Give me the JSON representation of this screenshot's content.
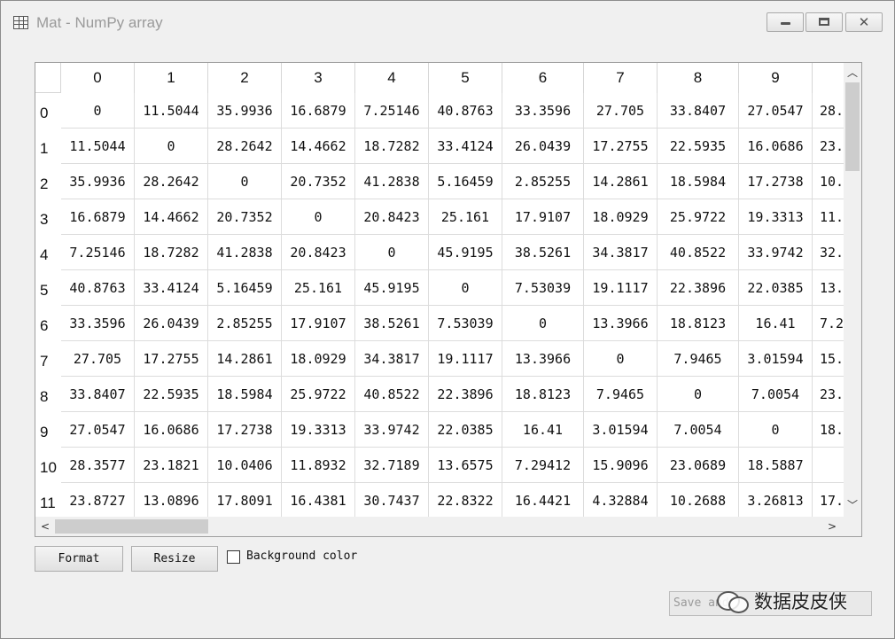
{
  "window": {
    "title": "Mat - NumPy array",
    "icon": "table-icon",
    "controls": [
      "minimize-icon",
      "maximize-icon",
      "close-icon"
    ]
  },
  "table": {
    "columns": [
      "0",
      "1",
      "2",
      "3",
      "4",
      "5",
      "6",
      "7",
      "8",
      "9"
    ],
    "rows": [
      {
        "label": "0",
        "cells": [
          "0",
          "11.5044",
          "35.9936",
          "16.6879",
          "7.25146",
          "40.8763",
          "33.3596",
          "27.705",
          "33.8407",
          "27.0547",
          "28."
        ]
      },
      {
        "label": "1",
        "cells": [
          "11.5044",
          "0",
          "28.2642",
          "14.4662",
          "18.7282",
          "33.4124",
          "26.0439",
          "17.2755",
          "22.5935",
          "16.0686",
          "23."
        ]
      },
      {
        "label": "2",
        "cells": [
          "35.9936",
          "28.2642",
          "0",
          "20.7352",
          "41.2838",
          "5.16459",
          "2.85255",
          "14.2861",
          "18.5984",
          "17.2738",
          "10."
        ]
      },
      {
        "label": "3",
        "cells": [
          "16.6879",
          "14.4662",
          "20.7352",
          "0",
          "20.8423",
          "25.161",
          "17.9107",
          "18.0929",
          "25.9722",
          "19.3313",
          "11."
        ]
      },
      {
        "label": "4",
        "cells": [
          "7.25146",
          "18.7282",
          "41.2838",
          "20.8423",
          "0",
          "45.9195",
          "38.5261",
          "34.3817",
          "40.8522",
          "33.9742",
          "32."
        ]
      },
      {
        "label": "5",
        "cells": [
          "40.8763",
          "33.4124",
          "5.16459",
          "25.161",
          "45.9195",
          "0",
          "7.53039",
          "19.1117",
          "22.3896",
          "22.0385",
          "13."
        ]
      },
      {
        "label": "6",
        "cells": [
          "33.3596",
          "26.0439",
          "2.85255",
          "17.9107",
          "38.5261",
          "7.53039",
          "0",
          "13.3966",
          "18.8123",
          "16.41",
          "7.2"
        ]
      },
      {
        "label": "7",
        "cells": [
          "27.705",
          "17.2755",
          "14.2861",
          "18.0929",
          "34.3817",
          "19.1117",
          "13.3966",
          "0",
          "7.9465",
          "3.01594",
          "15."
        ]
      },
      {
        "label": "8",
        "cells": [
          "33.8407",
          "22.5935",
          "18.5984",
          "25.9722",
          "40.8522",
          "22.3896",
          "18.8123",
          "7.9465",
          "0",
          "7.0054",
          "23."
        ]
      },
      {
        "label": "9",
        "cells": [
          "27.0547",
          "16.0686",
          "17.2738",
          "19.3313",
          "33.9742",
          "22.0385",
          "16.41",
          "3.01594",
          "7.0054",
          "0",
          "18."
        ]
      },
      {
        "label": "10",
        "cells": [
          "28.3577",
          "23.1821",
          "10.0406",
          "11.8932",
          "32.7189",
          "13.6575",
          "7.29412",
          "15.9096",
          "23.0689",
          "18.5887",
          ""
        ]
      },
      {
        "label": "11",
        "cells": [
          "23.8727",
          "13.0896",
          "17.8091",
          "16.4381",
          "30.7437",
          "22.8322",
          "16.4421",
          "4.32884",
          "10.2688",
          "3.26813",
          "17."
        ]
      }
    ]
  },
  "controls": {
    "format_label": "Format",
    "resize_label": "Resize",
    "background_color_label": "Background color",
    "background_color_checked": false,
    "save_label": "Save and"
  },
  "watermark": {
    "text": "数据皮皮侠",
    "icon": "wechat-icon"
  }
}
